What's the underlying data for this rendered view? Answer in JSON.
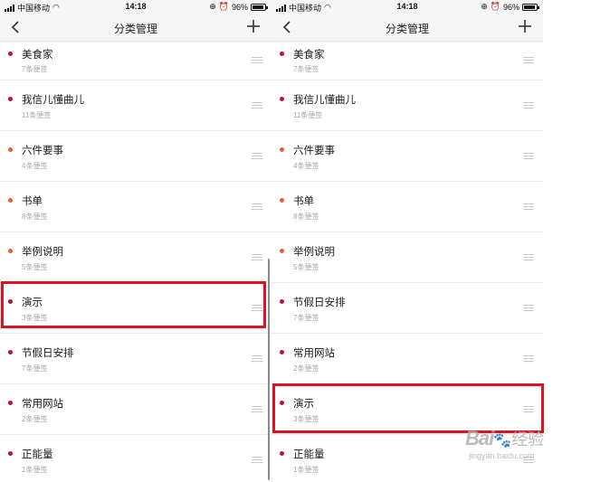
{
  "status_bar": {
    "carrier": "中国移动",
    "time": "14:18",
    "battery": "96%",
    "battery_level": 0.96
  },
  "nav": {
    "title": "分类管理"
  },
  "colors": {
    "dark_red_dot": "#c0102a",
    "orange_red_dot": "#ee5a3a",
    "highlight_border": "#e01020"
  },
  "left_list": [
    {
      "name": "美食家",
      "count": "7条便签",
      "dot": "dark"
    },
    {
      "name": "我信儿懂曲儿",
      "count": "11条便签",
      "dot": "dark"
    },
    {
      "name": "六件要事",
      "count": "4条便签",
      "dot": "light"
    },
    {
      "name": "书单",
      "count": "8条便签",
      "dot": "light"
    },
    {
      "name": "举例说明",
      "count": "5条便签",
      "dot": "light"
    },
    {
      "name": "演示",
      "count": "3条便签",
      "dot": "dark"
    },
    {
      "name": "节假日安排",
      "count": "7条便签",
      "dot": "dark"
    },
    {
      "name": "常用网站",
      "count": "2条便签",
      "dot": "dark"
    },
    {
      "name": "正能量",
      "count": "1条便签",
      "dot": "dark"
    }
  ],
  "right_list": [
    {
      "name": "美食家",
      "count": "7条便签",
      "dot": "dark"
    },
    {
      "name": "我信儿懂曲儿",
      "count": "11条便签",
      "dot": "dark"
    },
    {
      "name": "六件要事",
      "count": "4条便签",
      "dot": "light"
    },
    {
      "name": "书单",
      "count": "8条便签",
      "dot": "light"
    },
    {
      "name": "举例说明",
      "count": "5条便签",
      "dot": "light"
    },
    {
      "name": "节假日安排",
      "count": "7条便签",
      "dot": "dark"
    },
    {
      "name": "常用网站",
      "count": "2条便签",
      "dot": "dark"
    },
    {
      "name": "演示",
      "count": "3条便签",
      "dot": "dark"
    },
    {
      "name": "正能量",
      "count": "1条便签",
      "dot": "dark"
    }
  ],
  "watermark": {
    "brand": "Bai",
    "paw": "🐾",
    "suffix": "经验",
    "url": "jingyan.baidu.com"
  }
}
